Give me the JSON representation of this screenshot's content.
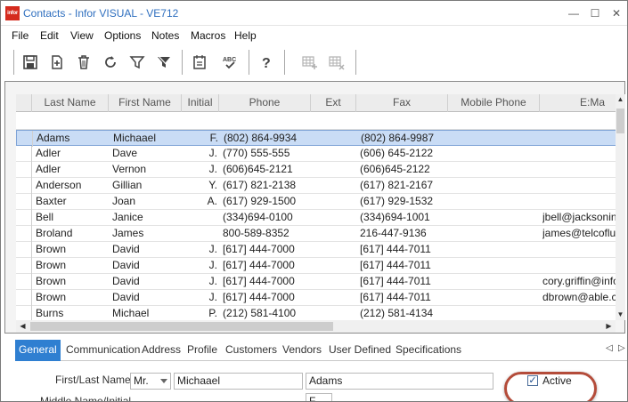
{
  "window": {
    "title": "Contacts - Infor VISUAL - VE712",
    "logo_text": "infor",
    "minimize": "—",
    "maximize": "☐",
    "close": "✕"
  },
  "menu": [
    "File",
    "Edit",
    "View",
    "Options",
    "Notes",
    "Macros",
    "Help"
  ],
  "toolbar": {
    "icons": [
      "save-icon",
      "new-icon",
      "delete-icon",
      "refresh-icon",
      "filter-icon",
      "clear-filter-icon",
      "notes-icon",
      "spellcheck-icon",
      "help-icon",
      "grid-add-icon",
      "grid-remove-icon"
    ]
  },
  "grid": {
    "columns": [
      "Last Name",
      "First Name",
      "Initial",
      "Phone",
      "Ext",
      "Fax",
      "Mobile Phone",
      "E:Ma"
    ],
    "rows": [
      [
        "Adams",
        "Michaael",
        "F.",
        "(802) 864-9934",
        "",
        "(802) 864-9987",
        "",
        ""
      ],
      [
        "Adler",
        "Dave",
        "J.",
        "(770) 555-555",
        "",
        "(606) 645-2122",
        "",
        ""
      ],
      [
        "Adler",
        "Vernon",
        "J.",
        "(606)645-2121",
        "",
        "(606)645-2122",
        "",
        ""
      ],
      [
        "Anderson",
        "Gillian",
        "Y.",
        "(617) 821-2138",
        "",
        "(617) 821-2167",
        "",
        ""
      ],
      [
        "Baxter",
        "Joan",
        "A.",
        "(617) 929-1500",
        "",
        "(617) 929-1532",
        "",
        ""
      ],
      [
        "Bell",
        "Janice",
        "",
        "(334)694-0100",
        "",
        "(334)694-1001",
        "",
        "jbell@jacksonind."
      ],
      [
        "Broland",
        "James",
        "",
        "800-589-8352",
        "",
        "216-447-9136",
        "",
        "james@telcofluidp"
      ],
      [
        "Brown",
        "David",
        "J.",
        "[617] 444-7000",
        "",
        "[617] 444-7011",
        "",
        ""
      ],
      [
        "Brown",
        "David",
        "J.",
        "[617] 444-7000",
        "",
        "[617] 444-7011",
        "",
        ""
      ],
      [
        "Brown",
        "David",
        "J.",
        "[617] 444-7000",
        "",
        "[617] 444-7011",
        "",
        "cory.griffin@infor."
      ],
      [
        "Brown",
        "David",
        "J.",
        "[617] 444-7000",
        "",
        "[617] 444-7011",
        "",
        "dbrown@able.co"
      ],
      [
        "Burns",
        "Michael",
        "P.",
        "(212) 581-4100",
        "",
        "(212) 581-4134",
        "",
        ""
      ]
    ]
  },
  "tabs": [
    "General",
    "Communication",
    "Address",
    "Profile",
    "Customers",
    "Vendors",
    "User Defined",
    "Specifications"
  ],
  "tab_arrows": {
    "left": "◁",
    "right": "▷"
  },
  "form": {
    "first_last_label": "First/Last Name",
    "middle_label": "Middle Name/Initial",
    "prefix": "Mr.",
    "first_name": "Michaael",
    "last_name": "Adams",
    "initial": "F",
    "active_label": "Active",
    "active_checked": true
  },
  "colors": {
    "accent": "#2f7fd1",
    "selection": "#c9dcf5",
    "highlight_ring": "#b44c3a",
    "logo": "#d52b1e"
  }
}
